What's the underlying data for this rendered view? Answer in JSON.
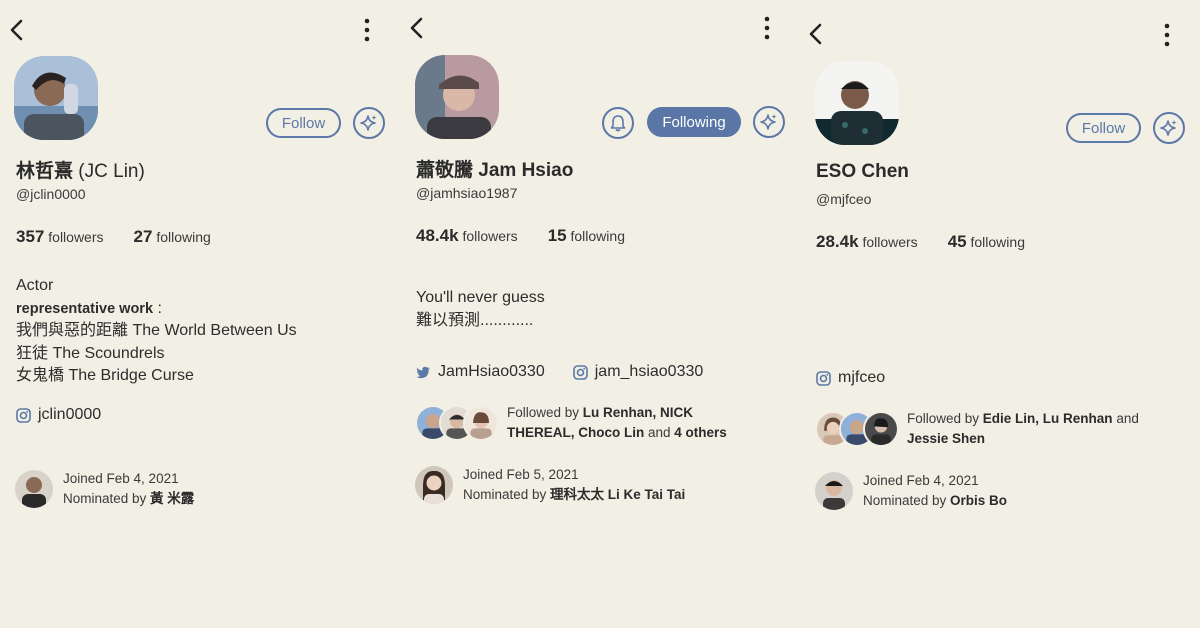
{
  "colors": {
    "background": "#f2efe4",
    "accent": "#5c78a8",
    "accent_filled": "#5a76a6",
    "text": "#2d2d2d"
  },
  "icons": {
    "back": "chevron-left-icon",
    "more": "more-vertical-icon",
    "sparkle": "sparkle-icon",
    "bell": "bell-icon",
    "instagram": "instagram-icon",
    "twitter": "twitter-icon"
  },
  "profiles": [
    {
      "name_main": "林哲熹",
      "name_paren": " (JC Lin)",
      "handle": "@jclin0000",
      "followers_count": "357",
      "followers_label": "followers",
      "following_count": "27",
      "following_label": "following",
      "follow_button": "Follow",
      "bio": {
        "line1": "Actor",
        "work_label": "representative work",
        "work_colon": " :",
        "line3": "我們與惡的距離 The World Between Us",
        "line4": "狂徒 The Scoundrels",
        "line5": "女鬼橋 The Bridge Curse"
      },
      "instagram": "jclin0000",
      "joined": "Joined Feb 4, 2021",
      "nominated_prefix": "Nominated by ",
      "nominated_by": "黃 米露"
    },
    {
      "name_main": "蕭敬騰 Jam Hsiao",
      "handle": "@jamhsiao1987",
      "followers_count": "48.4k",
      "followers_label": "followers",
      "following_count": "15",
      "following_label": "following",
      "follow_button": "Following",
      "bio": {
        "line1": "You'll never guess",
        "line2": "難以預測............"
      },
      "twitter": "JamHsiao0330",
      "instagram": "jam_hsiao0330",
      "followed_prefix": "Followed by ",
      "followed_names_1": "Lu Renhan, NICK",
      "followed_names_2": "THEREAL, Choco Lin",
      "followed_and": " and ",
      "followed_others": "4 others",
      "joined": "Joined Feb 5, 2021",
      "nominated_prefix": "Nominated by ",
      "nominated_by": "理科太太 Li Ke Tai Tai"
    },
    {
      "name_main": "ESO Chen",
      "handle": "@mjfceo",
      "followers_count": "28.4k",
      "followers_label": "followers",
      "following_count": "45",
      "following_label": "following",
      "follow_button": "Follow",
      "instagram": "mjfceo",
      "followed_prefix": "Followed by ",
      "followed_names_1": "Edie Lin, Lu Renhan",
      "followed_and": " and",
      "followed_names_2": "Jessie Shen",
      "joined": "Joined Feb 4, 2021",
      "nominated_prefix": "Nominated by ",
      "nominated_by": "Orbis Bo"
    }
  ]
}
